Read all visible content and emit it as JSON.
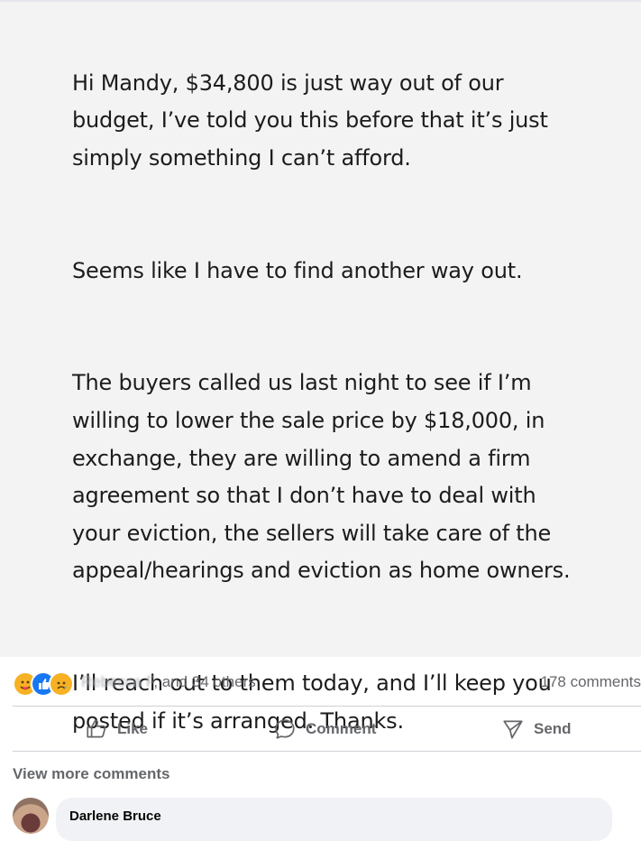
{
  "post": {
    "paragraphs": [
      "Hi Mandy, $34,800 is just way out of our budget, I’ve told you this before that it’s just simply something I can’t afford.",
      "Seems like I have to find another way out.",
      "The buyers called us last night to see if I’m  willing to lower the sale price by $18,000, in exchange, they are willing to amend a firm agreement so that I don’t have to deal with your eviction, the sellers will take care of the appeal/hearings and eviction as home owners.",
      "I’ll reach out to them today, and I’ll keep you posted if it’s arranged. Thanks."
    ]
  },
  "reactions": {
    "icons": [
      "care-reaction-icon",
      "like-reaction-icon",
      "sad-reaction-icon"
    ],
    "reactors_blurred": "Rebecca F",
    "reactors_suffix": ", and 34 others",
    "comments_count": "178 comments"
  },
  "actions": {
    "like_label": "Like",
    "comment_label": "Comment",
    "send_label": "Send"
  },
  "view_more_label": "View more comments",
  "comment": {
    "author": "Darlene Bruce"
  },
  "colors": {
    "like_blue": "#1877f2",
    "reaction_yellow": "#f7b125",
    "secondary_text": "#65676b",
    "bubble_bg": "#f0f2f5"
  }
}
